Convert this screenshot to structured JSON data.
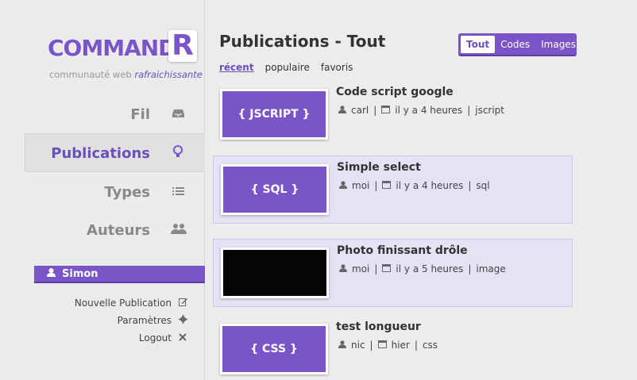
{
  "brand": {
    "logo_text": "COMMAND",
    "logo_letter": "R",
    "tagline_prefix": "communauté web",
    "tagline_emph": "rafraichissante"
  },
  "nav": [
    {
      "label": "Fil",
      "icon": "inbox-icon",
      "glyph": "▭"
    },
    {
      "label": "Publications",
      "icon": "lightbulb-icon",
      "glyph": "♁"
    },
    {
      "label": "Types",
      "icon": "list-icon",
      "glyph": "☰"
    },
    {
      "label": "Auteurs",
      "icon": "group-icon",
      "glyph": "☻"
    }
  ],
  "user": {
    "name": "Simon",
    "links": [
      {
        "label": "Nouvelle Publication",
        "icon": "edit-icon",
        "glyph": "✎"
      },
      {
        "label": "Paramètres",
        "icon": "gear-icon",
        "glyph": "✱"
      },
      {
        "label": "Logout",
        "icon": "close-icon",
        "glyph": "✕"
      }
    ]
  },
  "page": {
    "title": "Publications - Tout"
  },
  "filters": [
    "récent",
    "populaire",
    "favoris"
  ],
  "type_tabs": [
    "Tout",
    "Codes",
    "Images"
  ],
  "posts": [
    {
      "thumb": "{ JSCRIPT }",
      "title": "Code script google",
      "author": "carl",
      "time": "il y a 4 heures",
      "type": "jscript"
    },
    {
      "thumb": "{ SQL }",
      "title": "Simple select",
      "author": "moi",
      "time": "il y a 4 heures",
      "type": "sql"
    },
    {
      "thumb": "",
      "title": "Photo finissant drôle",
      "author": "moi",
      "time": "il y a 5 heures",
      "type": "image"
    },
    {
      "thumb": "{ CSS }",
      "title": "test longueur",
      "author": "nic",
      "time": "hier",
      "type": "css"
    }
  ],
  "colors": {
    "accent": "#7a55c8",
    "highlight": "#e6e1f5"
  }
}
